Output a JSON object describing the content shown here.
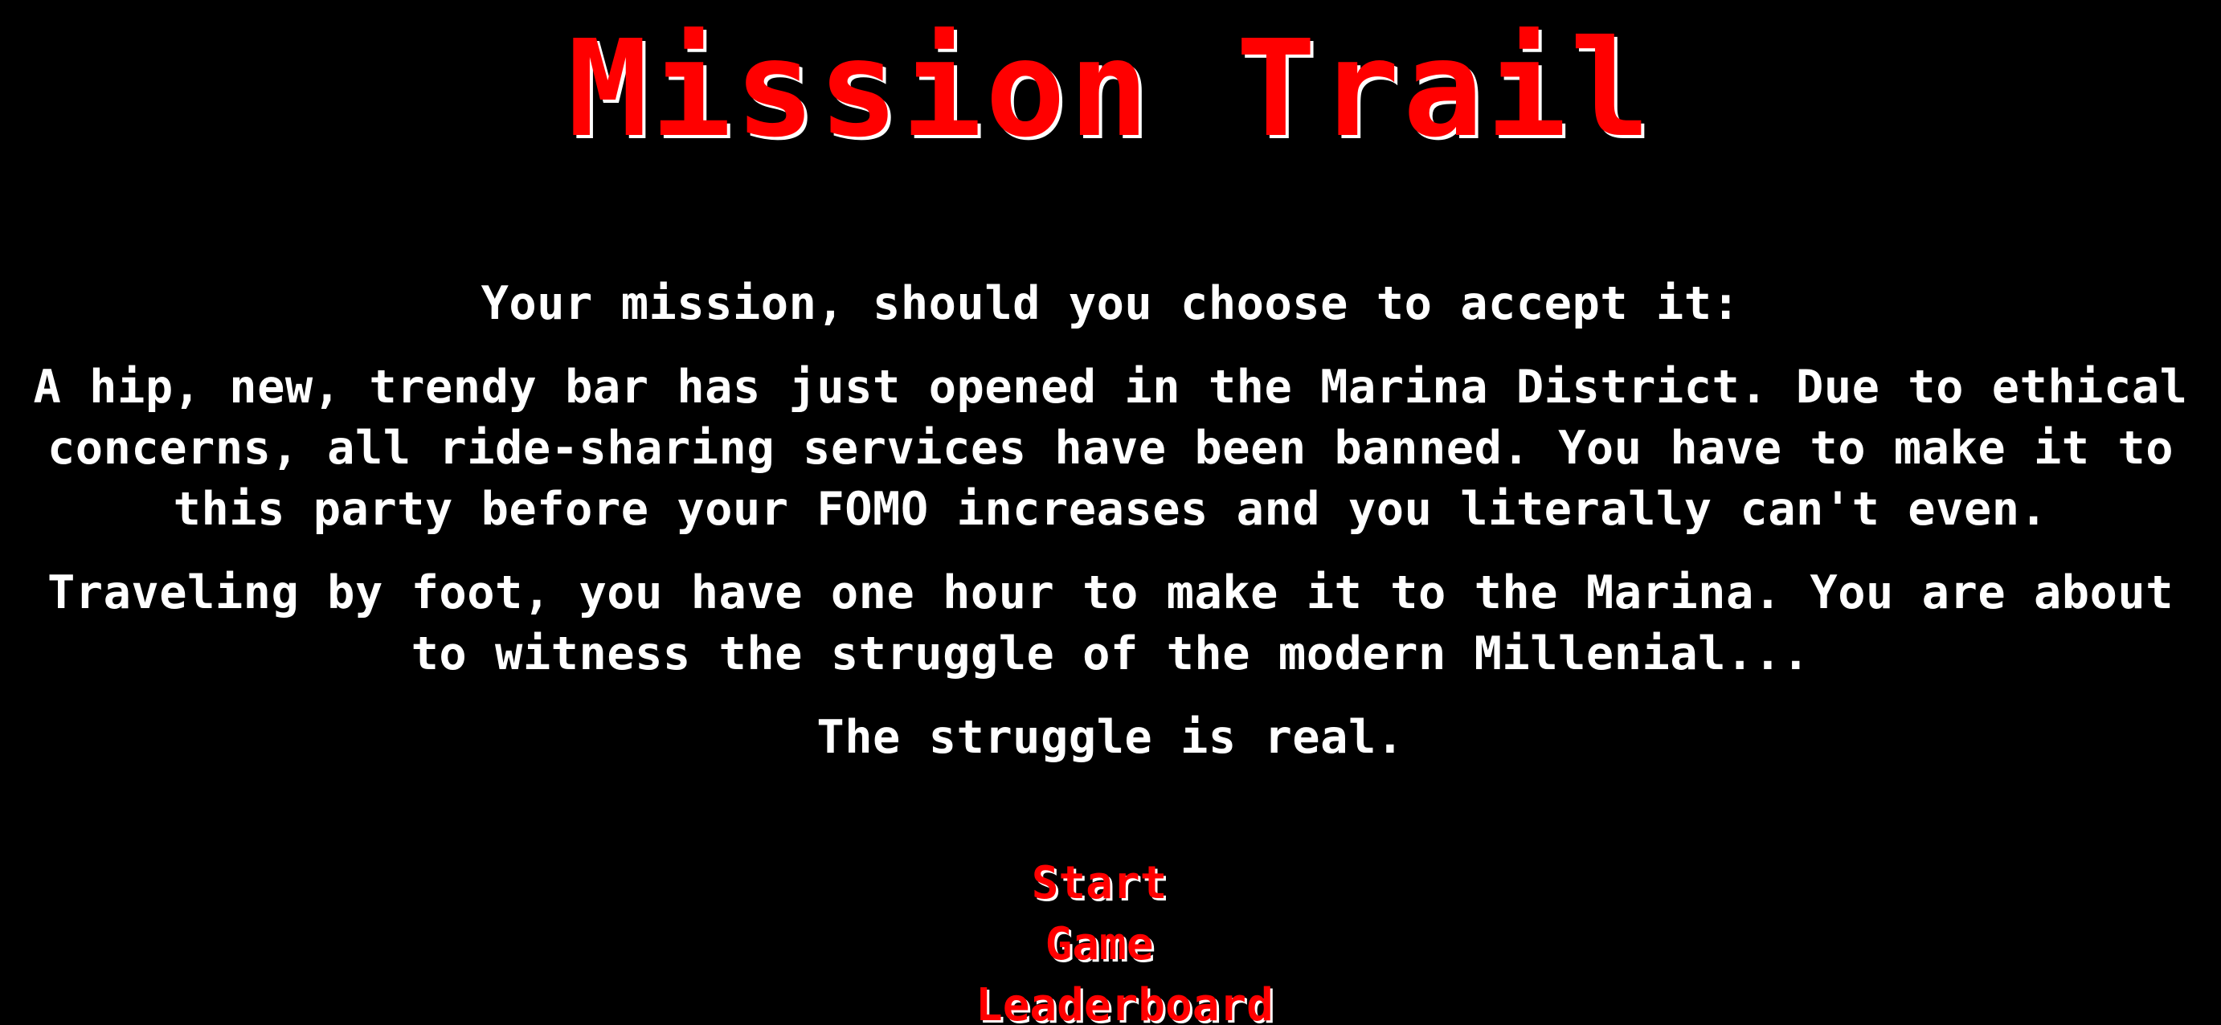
{
  "title": "Mission Trail",
  "intro": {
    "tagline": "Your mission, should you choose to accept it:",
    "story": "A hip, new, trendy bar has just opened in the Marina District. Due to ethical concerns, all ride-sharing services have been banned. You have to make it to this party before your FOMO increases and you literally can't even.",
    "travel": "Traveling by foot, you have one hour to make it to the Marina. You are about to witness the struggle of the modern Millenial...",
    "closing": "The struggle is real."
  },
  "menu": {
    "start_label": "Start Game",
    "leaderboard_label": "Leaderboard"
  },
  "colors": {
    "background": "#000000",
    "text": "#ffffff",
    "accent": "#ff0000"
  }
}
